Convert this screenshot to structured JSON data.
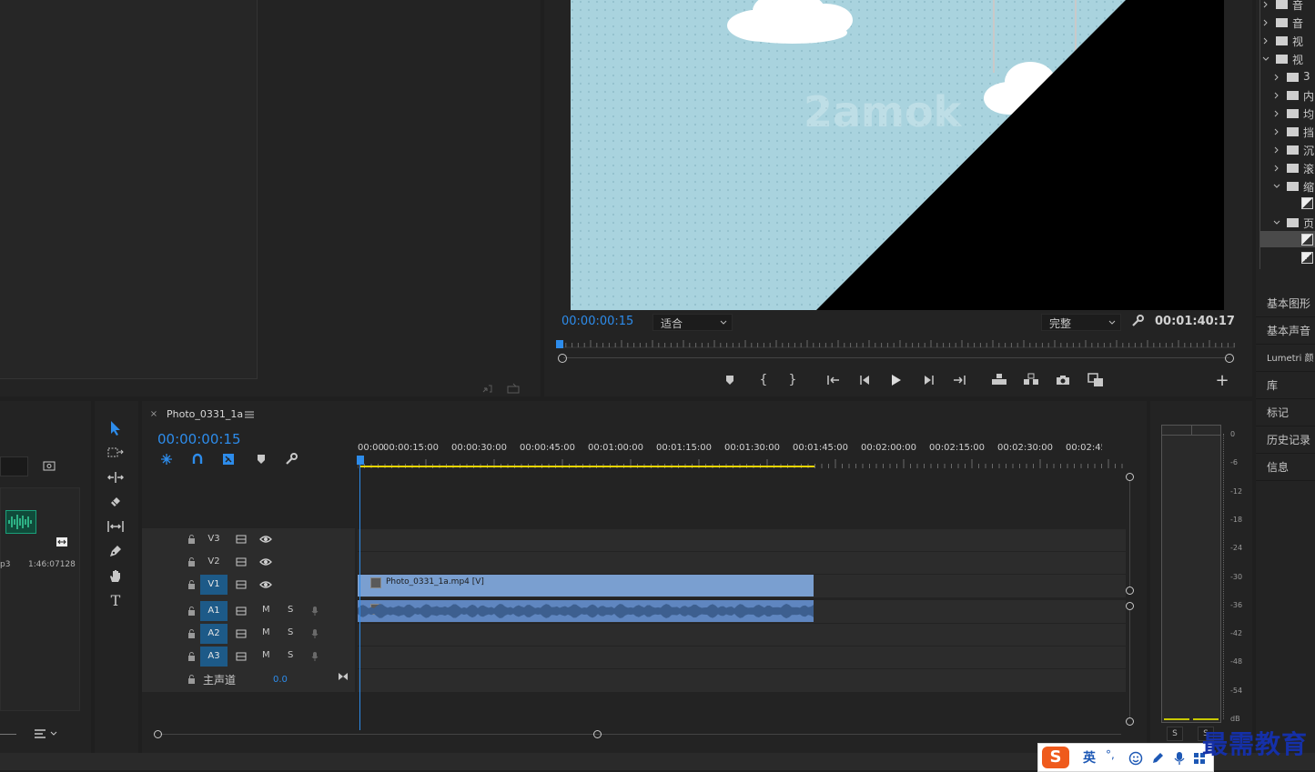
{
  "program_monitor": {
    "timecode": "00:00:00:15",
    "fit_select": "适合",
    "quality_select": "完整",
    "duration": "00:01:40:17",
    "watermark": "2amok"
  },
  "timeline": {
    "sequence_tab": "Photo_0331_1a",
    "timecode": "00:00:00:15",
    "ruler": [
      "00:00",
      "00:00:15:00",
      "00:00:30:00",
      "00:00:45:00",
      "00:01:00:00",
      "00:01:15:00",
      "00:01:30:00",
      "00:01:45:00",
      "00:02:00:00",
      "00:02:15:00",
      "00:02:30:00",
      "00:02:45:00"
    ],
    "tracks": {
      "video": [
        "V3",
        "V2",
        "V1"
      ],
      "audio": [
        "A1",
        "A2",
        "A3"
      ],
      "mute": "M",
      "solo": "S",
      "master_label": "主声道",
      "master_value": "0.0"
    },
    "clip_video_label": "Photo_0331_1a.mp4 [V]",
    "clip_fx": "fx"
  },
  "project_panel": {
    "item_name_fragment": "p3",
    "item_duration": "1:46:07128"
  },
  "effects_tree": {
    "items": [
      "音",
      "音",
      "视",
      "视",
      "3",
      "内",
      "均",
      "挡",
      "沉",
      "滚",
      "缩",
      "页"
    ]
  },
  "right_panels": [
    "基本图形",
    "基本声音",
    "Lumetri 颜",
    "库",
    "标记",
    "历史记录",
    "信息"
  ],
  "audio_meter": {
    "ticks": [
      "0",
      "-6",
      "-12",
      "-18",
      "-24",
      "-30",
      "-36",
      "-42",
      "-48",
      "-54",
      "dB"
    ],
    "solo_labels": [
      "S",
      "S"
    ]
  },
  "ime_bar": {
    "lang": "英",
    "punct": "°,"
  },
  "watermark_brand": "最需教育",
  "colors": {
    "accent_blue": "#2d8ceb",
    "video_clip": "#7a9fd0",
    "audio_clip": "#5f86c0",
    "track_on": "#1d5a88",
    "work_area": "#e8d400"
  }
}
